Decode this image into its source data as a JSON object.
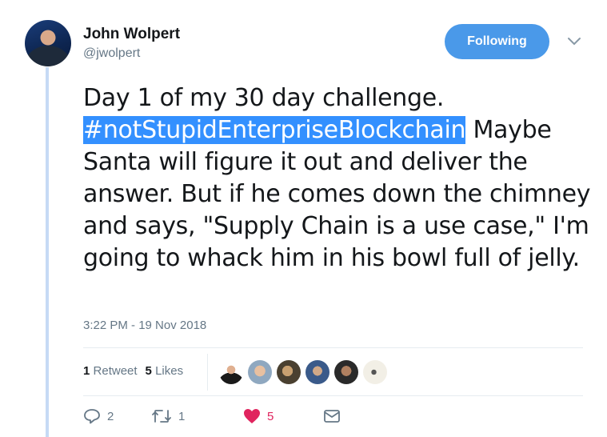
{
  "author": {
    "name": "John Wolpert",
    "handle": "@jwolpert"
  },
  "follow_button": {
    "label": "Following",
    "color": "#4a99e9"
  },
  "tweet": {
    "line1": "Day 1 of my 30 day challenge.",
    "hashtag": "#notStupidEnterpriseBlockchain",
    "rest": " Maybe Santa will figure it out and deliver the answer. But if he comes down the chimney and says, \"Supply Chain is a use case,\" I'm going to whack him in his bowl full of jelly.",
    "timestamp": "3:22 PM - 19 Nov 2018"
  },
  "stats": {
    "retweets_count": "1",
    "retweets_label": "Retweet",
    "likes_count": "5",
    "likes_label": "Likes"
  },
  "likers": [
    {
      "name": "liker-1",
      "color": "#3a3a3a"
    },
    {
      "name": "liker-2",
      "color": "#c9a080"
    },
    {
      "name": "liker-3",
      "color": "#8a7a5a"
    },
    {
      "name": "liker-4",
      "color": "#5a6e8a"
    },
    {
      "name": "liker-5",
      "color": "#6a4a3a"
    },
    {
      "name": "liker-6",
      "color": "#e8e4da"
    }
  ],
  "actions": {
    "replies": "2",
    "retweets": "1",
    "likes": "5",
    "like_color": "#e0245e"
  },
  "icons": [
    "reply-icon",
    "retweet-icon",
    "heart-icon",
    "message-icon",
    "chevron-down-icon"
  ],
  "colors": {
    "accent": "#4a99e9",
    "hashtag_highlight": "#3390ff",
    "muted": "#657786"
  }
}
